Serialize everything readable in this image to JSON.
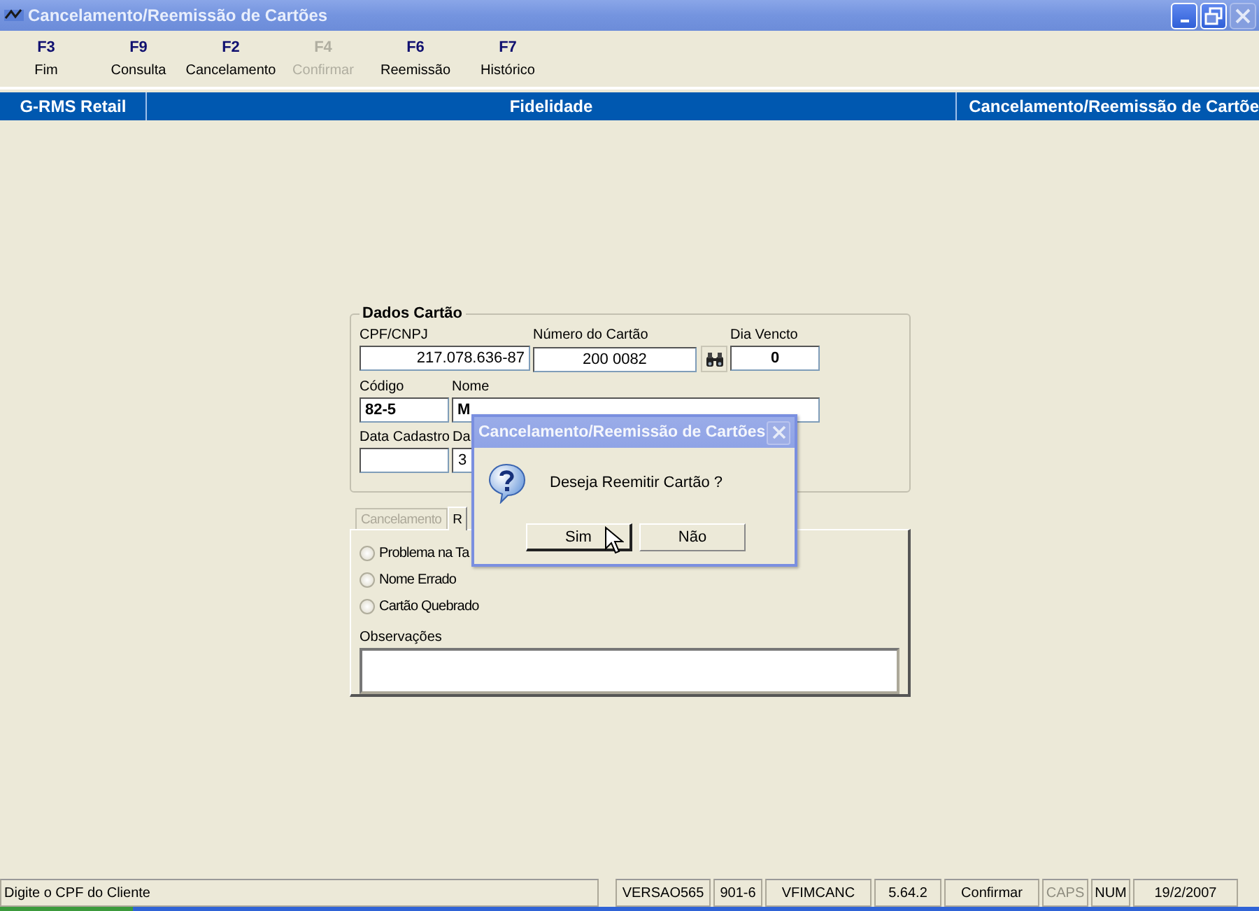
{
  "window": {
    "title": "Cancelamento/Reemissão de Cartões",
    "controls": [
      {
        "kind": "minimize",
        "disabled": false
      },
      {
        "kind": "restore",
        "disabled": false
      },
      {
        "kind": "close",
        "disabled": true
      }
    ]
  },
  "toolbar": [
    {
      "key": "F3",
      "label": "Fim",
      "disabled": false
    },
    {
      "key": "F9",
      "label": "Consulta",
      "disabled": false
    },
    {
      "key": "F2",
      "label": "Cancelamento",
      "disabled": false
    },
    {
      "key": "F4",
      "label": "Confirmar",
      "disabled": true
    },
    {
      "key": "F6",
      "label": "Reemissão",
      "disabled": false
    },
    {
      "key": "F7",
      "label": "Histórico",
      "disabled": false
    }
  ],
  "header": {
    "left": "G-RMS Retail",
    "center": "Fidelidade",
    "right": "Cancelamento/Reemissão de Cartõe"
  },
  "card_group": {
    "title": "Dados Cartão",
    "rows": [
      [
        {
          "label": "CPF/CNPJ",
          "value": "217.078.636-87",
          "kind": "id"
        },
        {
          "label": "Número do Cartão",
          "value": "200 0082",
          "kind": "card"
        },
        {
          "label": "Dia Vencto",
          "value": "0",
          "kind": "day"
        }
      ],
      [
        {
          "label": "Código",
          "value": "82-5",
          "kind": "code"
        },
        {
          "label": "Nome",
          "value": "M",
          "kind": "name"
        }
      ],
      [
        {
          "label": "Data Cadastro",
          "kind": "date"
        },
        {
          "label": "Da",
          "value": "3",
          "kind": "date"
        }
      ]
    ]
  },
  "tabs": [
    {
      "label": "Cancelamento",
      "selected": false,
      "disabled": true
    },
    {
      "label": "R",
      "selected": true,
      "disabled": false
    }
  ],
  "reasons": [
    {
      "label": "Problema na Ta",
      "selected": false
    },
    {
      "label": "Nome Errado",
      "selected": false
    },
    {
      "label": "Cartão Quebrado",
      "selected": false
    }
  ],
  "notes": {
    "label": "Observações"
  },
  "dialog": {
    "title": "Cancelamento/Reemissão de Cartões",
    "message": "Deseja Reemitir Cartão ?",
    "buttons": [
      {
        "label": "Sim",
        "default": true
      },
      {
        "label": "Não",
        "default": false
      }
    ]
  },
  "status_bar": [
    {
      "text": "Digite o CPF do Cliente",
      "disabled": false
    },
    {
      "text": "VERSAO565",
      "disabled": false
    },
    {
      "text": "901-6",
      "disabled": false
    },
    {
      "text": "VFIMCANC",
      "disabled": false
    },
    {
      "text": "5.64.2",
      "disabled": false
    },
    {
      "text": "Confirmar",
      "disabled": false
    },
    {
      "text": "CAPS",
      "disabled": true
    },
    {
      "text": "NUM",
      "disabled": false
    },
    {
      "text": "19/2/2007",
      "disabled": false
    }
  ]
}
